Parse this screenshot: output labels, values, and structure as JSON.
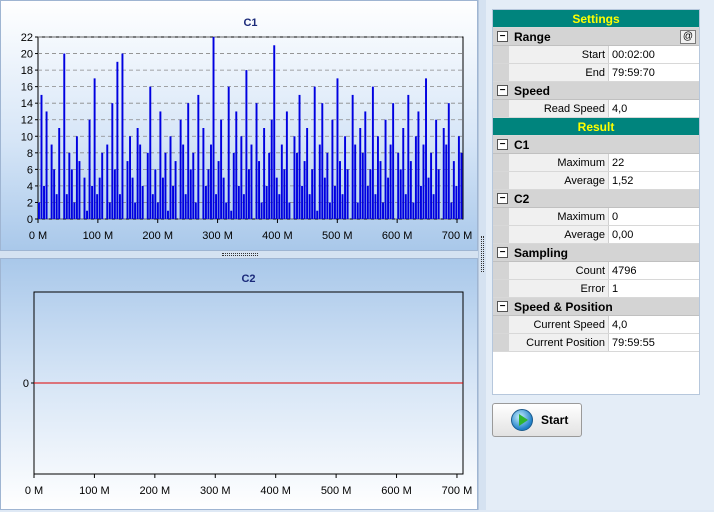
{
  "charts": [
    {
      "id": "c1",
      "title": "C1",
      "x_ticks": [
        "0 M",
        "100 M",
        "200 M",
        "300 M",
        "400 M",
        "500 M",
        "600 M",
        "700 M"
      ],
      "y_ticks": [
        "0",
        "2",
        "4",
        "6",
        "8",
        "10",
        "12",
        "14",
        "16",
        "18",
        "20",
        "22"
      ]
    },
    {
      "id": "c2",
      "title": "C2",
      "x_ticks": [
        "0 M",
        "100 M",
        "200 M",
        "300 M",
        "400 M",
        "500 M",
        "600 M",
        "700 M"
      ],
      "y_ticks": [
        "0"
      ]
    }
  ],
  "chart_data": [
    {
      "type": "bar",
      "title": "C1",
      "xlim": [
        0,
        710
      ],
      "ylim": [
        0,
        22
      ],
      "grid": true,
      "color": "#0000e0",
      "x_unit": "M",
      "values": [
        2,
        15,
        4,
        13,
        0,
        9,
        6,
        3,
        11,
        0,
        20,
        3,
        8,
        6,
        2,
        10,
        7,
        0,
        5,
        1,
        12,
        4,
        17,
        3,
        5,
        8,
        0,
        9,
        2,
        14,
        6,
        19,
        3,
        20,
        0,
        7,
        10,
        5,
        2,
        11,
        9,
        4,
        0,
        8,
        16,
        3,
        6,
        2,
        13,
        5,
        8,
        1,
        10,
        4,
        7,
        0,
        12,
        9,
        3,
        14,
        6,
        8,
        2,
        15,
        0,
        11,
        4,
        6,
        9,
        22,
        3,
        7,
        12,
        5,
        2,
        16,
        1,
        8,
        13,
        4,
        10,
        3,
        18,
        6,
        9,
        0,
        14,
        7,
        2,
        11,
        4,
        8,
        12,
        21,
        5,
        3,
        9,
        6,
        13,
        2,
        0,
        10,
        8,
        15,
        4,
        7,
        11,
        3,
        6,
        16,
        1,
        9,
        14,
        5,
        8,
        2,
        12,
        4,
        17,
        7,
        3,
        10,
        6,
        0,
        15,
        9,
        2,
        11,
        8,
        13,
        4,
        6,
        16,
        3,
        10,
        7,
        2,
        12,
        5,
        9,
        14,
        0,
        8,
        6,
        11,
        3,
        15,
        7,
        2,
        10,
        13,
        4,
        9,
        17,
        5,
        8,
        3,
        12,
        6,
        0,
        11,
        9,
        14,
        2,
        7,
        4,
        10,
        8
      ]
    },
    {
      "type": "line",
      "title": "C2",
      "xlim": [
        0,
        710
      ],
      "ylim": [
        -1,
        1
      ],
      "grid": false,
      "color": "#e00000",
      "x_unit": "M",
      "values": [
        0,
        0
      ]
    }
  ],
  "settings": {
    "title": "Settings",
    "range": {
      "label": "Range",
      "start_label": "Start",
      "start_value": "00:02:00",
      "end_label": "End",
      "end_value": "79:59:70",
      "at_button": "@"
    },
    "speed": {
      "label": "Speed",
      "read_speed_label": "Read Speed",
      "read_speed_value": "4,0"
    }
  },
  "result": {
    "title": "Result",
    "c1": {
      "label": "C1",
      "maximum_label": "Maximum",
      "maximum_value": "22",
      "average_label": "Average",
      "average_value": "1,52"
    },
    "c2": {
      "label": "C2",
      "maximum_label": "Maximum",
      "maximum_value": "0",
      "average_label": "Average",
      "average_value": "0,00"
    },
    "sampling": {
      "label": "Sampling",
      "count_label": "Count",
      "count_value": "4796",
      "error_label": "Error",
      "error_value": "1"
    },
    "speed_position": {
      "label": "Speed & Position",
      "current_speed_label": "Current Speed",
      "current_speed_value": "4,0",
      "current_position_label": "Current Position",
      "current_position_value": "79:59:55"
    }
  },
  "collapse_glyph": "−",
  "start_button": {
    "label": "Start",
    "icon": "play-icon"
  }
}
